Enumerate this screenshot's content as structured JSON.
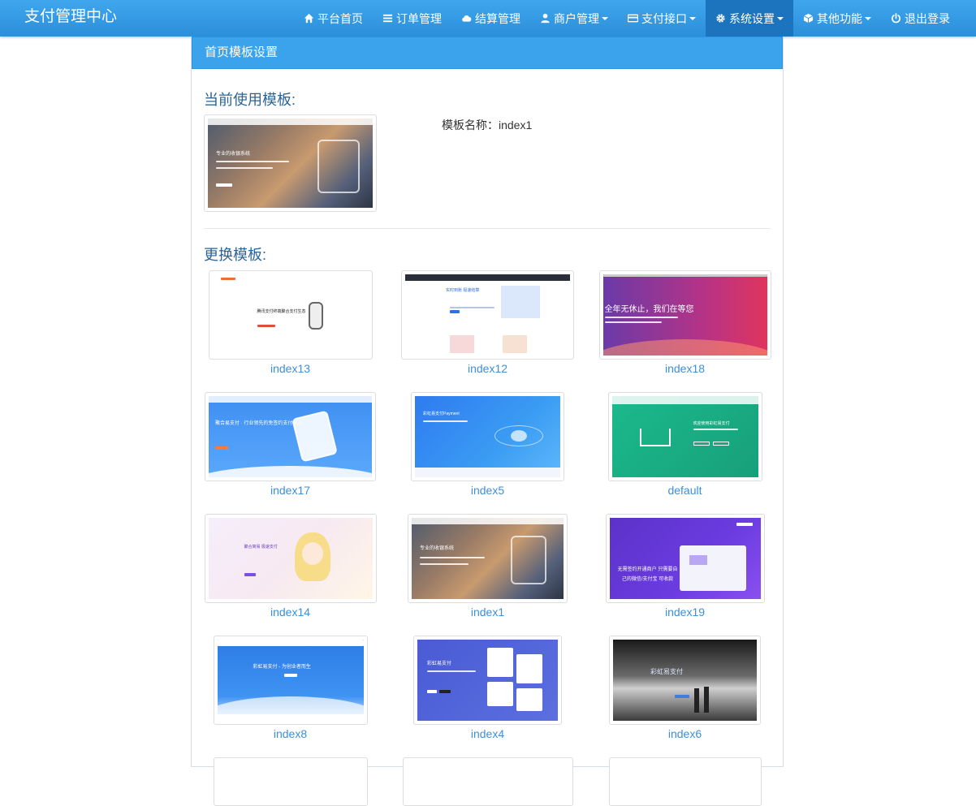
{
  "brand": "支付管理中心",
  "nav": [
    {
      "label": "平台首页",
      "icon": "home-icon",
      "caret": false,
      "active": false
    },
    {
      "label": "订单管理",
      "icon": "list-icon",
      "caret": false,
      "active": false
    },
    {
      "label": "结算管理",
      "icon": "cloud-icon",
      "caret": false,
      "active": false
    },
    {
      "label": "商户管理",
      "icon": "user-icon",
      "caret": true,
      "active": false
    },
    {
      "label": "支付接口",
      "icon": "credit-card-icon",
      "caret": true,
      "active": false
    },
    {
      "label": "系统设置",
      "icon": "gear-icon",
      "caret": true,
      "active": true
    },
    {
      "label": "其他功能",
      "icon": "cube-icon",
      "caret": true,
      "active": false
    },
    {
      "label": "退出登录",
      "icon": "power-icon",
      "caret": false,
      "active": false
    }
  ],
  "panel": {
    "heading": "首页模板设置",
    "current_title": "当前使用模板:",
    "current_name_label": "模板名称：index1",
    "change_title": "更换模板:"
  },
  "templates": [
    "index13",
    "index12",
    "index18",
    "index17",
    "index5",
    "default",
    "index14",
    "index1",
    "index19",
    "index8",
    "index4",
    "index6"
  ],
  "thumb_texts": {
    "cur_slogan": "专业的收银系统",
    "index13_slogan": "腾讯支付终端聚合支付生态",
    "index12_slogan": "实时到账 极速结算",
    "index18_slogan": "全年无休止，我们在等您",
    "index17_slogan": "聚合易支付 · 行业领先的免签约支付平台",
    "index5_slogan": "彩虹易支付Payment",
    "default_slogan": "欢迎使用彩虹易支付",
    "index14_slogan": "聚合简易 极速支付",
    "index1_slogan": "专业的收银系统",
    "index19_slogan": "无需签约开通商户 只需要自己的微信/支付宝 可收款",
    "index8_slogan": "彩虹易支付 - 为创业者而生",
    "index4_slogan": "彩虹易支付",
    "index6_slogan": "彩虹易支付"
  }
}
